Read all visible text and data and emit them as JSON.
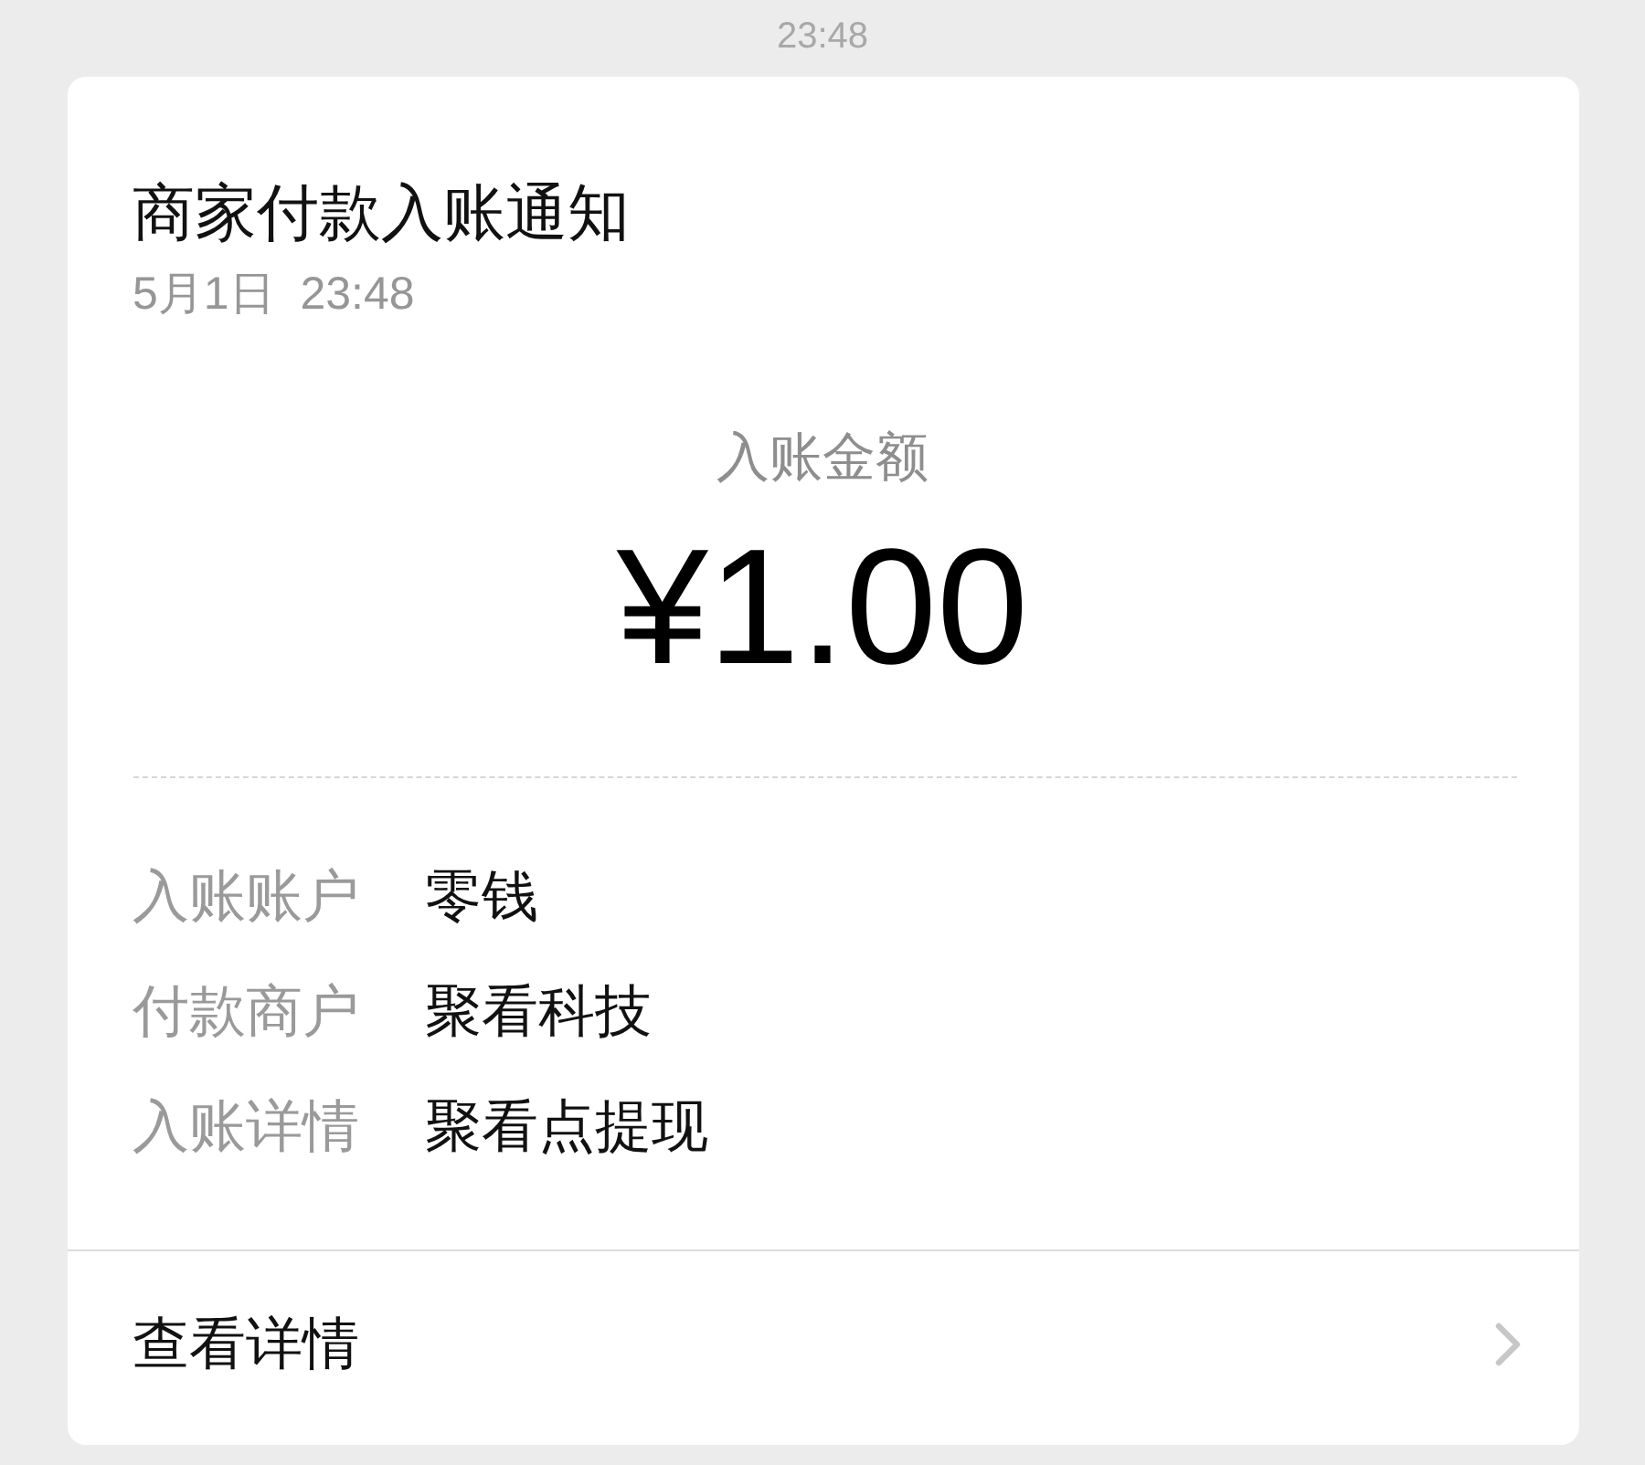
{
  "chat_time": "23:48",
  "card": {
    "title": "商家付款入账通知",
    "date": "5月1日  23:48",
    "amount_label": "入账金额",
    "amount": "¥1.00",
    "details": [
      {
        "label": "入账账户",
        "value": "零钱"
      },
      {
        "label": "付款商户",
        "value": "聚看科技"
      },
      {
        "label": "入账详情",
        "value": "聚看点提现"
      }
    ],
    "footer": {
      "label": "查看详情"
    }
  }
}
